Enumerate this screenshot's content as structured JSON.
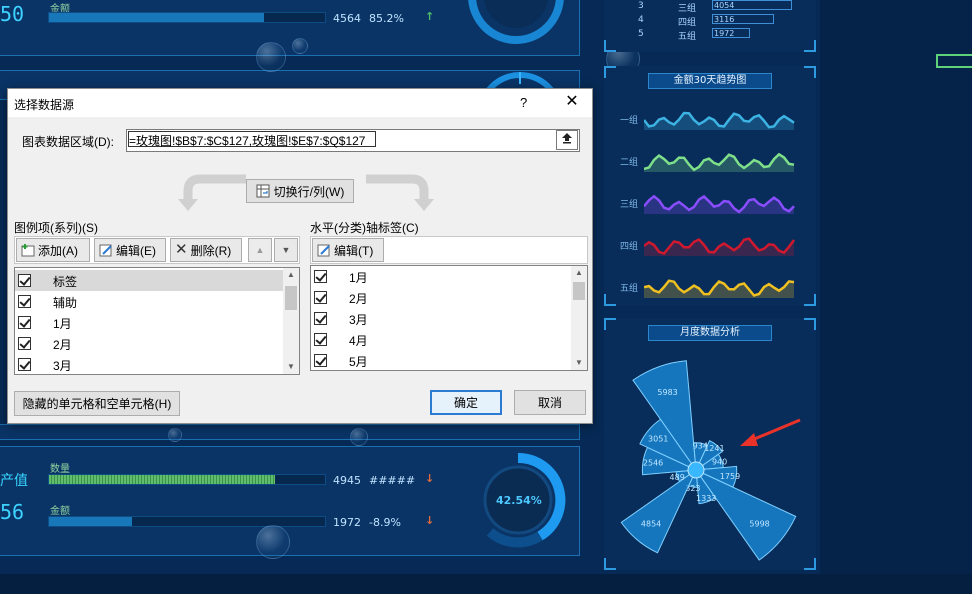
{
  "dashboard": {
    "top_left": {
      "value_partial": "50",
      "metric_label": "金额",
      "value": "4564",
      "percent": "85.2%",
      "bar_fill": 0.78
    },
    "bottom_left": {
      "title_partial": "产值",
      "value_partial": "56",
      "row1": {
        "label": "数量",
        "value": "4945",
        "percent": "#####",
        "bar_fill": 0.82
      },
      "row2": {
        "label": "金额",
        "value": "1972",
        "percent": "-8.9%",
        "bar_fill": 0.3
      },
      "gauge_percent": "42.54%"
    },
    "top_right_rows": [
      {
        "rank": "3",
        "name": "三组",
        "value": "4054"
      },
      {
        "rank": "4",
        "name": "四组",
        "value": "3116"
      },
      {
        "rank": "5",
        "name": "五组",
        "value": "1972"
      }
    ],
    "trend_panel": {
      "title": "金额30天趋势图",
      "groups": [
        {
          "label": "一组",
          "color": "#3db3e3"
        },
        {
          "label": "二组",
          "color": "#7fe08a"
        },
        {
          "label": "三组",
          "color": "#8a4dff"
        },
        {
          "label": "四组",
          "color": "#d0182e"
        },
        {
          "label": "五组",
          "color": "#f0c020"
        }
      ]
    },
    "rose_panel": {
      "title": "月度数据分析"
    }
  },
  "chart_data": {
    "type": "rose",
    "title": "月度数据分析",
    "values": [
      5983,
      934,
      1241,
      940,
      1759,
      5998,
      1333,
      323,
      4854,
      489,
      2546,
      3051
    ],
    "labels": [
      "5983",
      "934",
      "1241",
      "940",
      "1759",
      "5998",
      "1333",
      "323",
      "4854",
      "489",
      "2546",
      "3051"
    ]
  },
  "dialog": {
    "title": "选择数据源",
    "help": "?",
    "close": "✕",
    "range_label": "图表数据区域(D):",
    "range_label_hotkey": "D",
    "range_value": "=玫瑰图!$B$7:$C$127,玫瑰图!$E$7:$Q$127",
    "switch_button": "切换行/列(W)",
    "legend_section": "图例项(系列)(S)",
    "axis_section": "水平(分类)轴标签(C)",
    "add": "添加(A)",
    "edit": "编辑(E)",
    "delete": "删除(R)",
    "axis_edit": "编辑(T)",
    "series": [
      "标签",
      "辅助",
      "1月",
      "2月",
      "3月"
    ],
    "categories": [
      "1月",
      "2月",
      "3月",
      "4月",
      "5月"
    ],
    "hidden_cells": "隐藏的单元格和空单元格(H)",
    "ok": "确定",
    "cancel": "取消"
  }
}
